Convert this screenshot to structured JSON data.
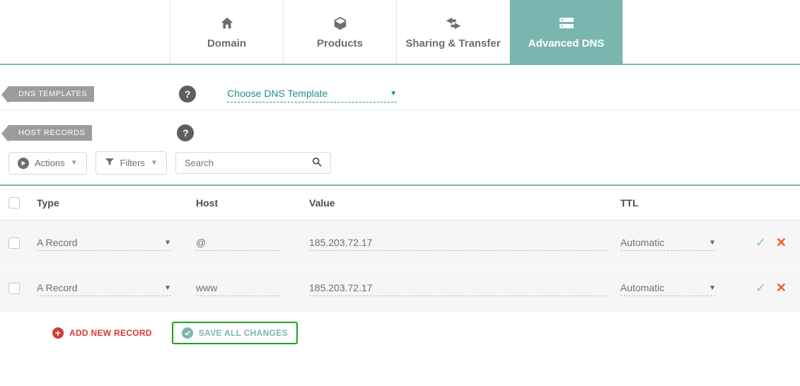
{
  "tabs": [
    {
      "label": "Domain",
      "icon": "home-icon"
    },
    {
      "label": "Products",
      "icon": "box-icon"
    },
    {
      "label": "Sharing & Transfer",
      "icon": "share-icon"
    },
    {
      "label": "Advanced DNS",
      "icon": "server-icon",
      "active": true
    }
  ],
  "sections": {
    "dns_templates": {
      "tag": "DNS TEMPLATES",
      "select_placeholder": "Choose DNS Template"
    },
    "host_records": {
      "tag": "HOST RECORDS"
    }
  },
  "toolbar": {
    "actions_label": "Actions",
    "filters_label": "Filters",
    "search_placeholder": "Search"
  },
  "table": {
    "headers": {
      "type": "Type",
      "host": "Host",
      "value": "Value",
      "ttl": "TTL"
    },
    "rows": [
      {
        "type": "A Record",
        "host": "@",
        "value": "185.203.72.17",
        "ttl": "Automatic"
      },
      {
        "type": "A Record",
        "host": "www",
        "value": "185.203.72.17",
        "ttl": "Automatic"
      }
    ]
  },
  "footer": {
    "add_label": "ADD NEW RECORD",
    "save_label": "SAVE ALL CHANGES"
  }
}
